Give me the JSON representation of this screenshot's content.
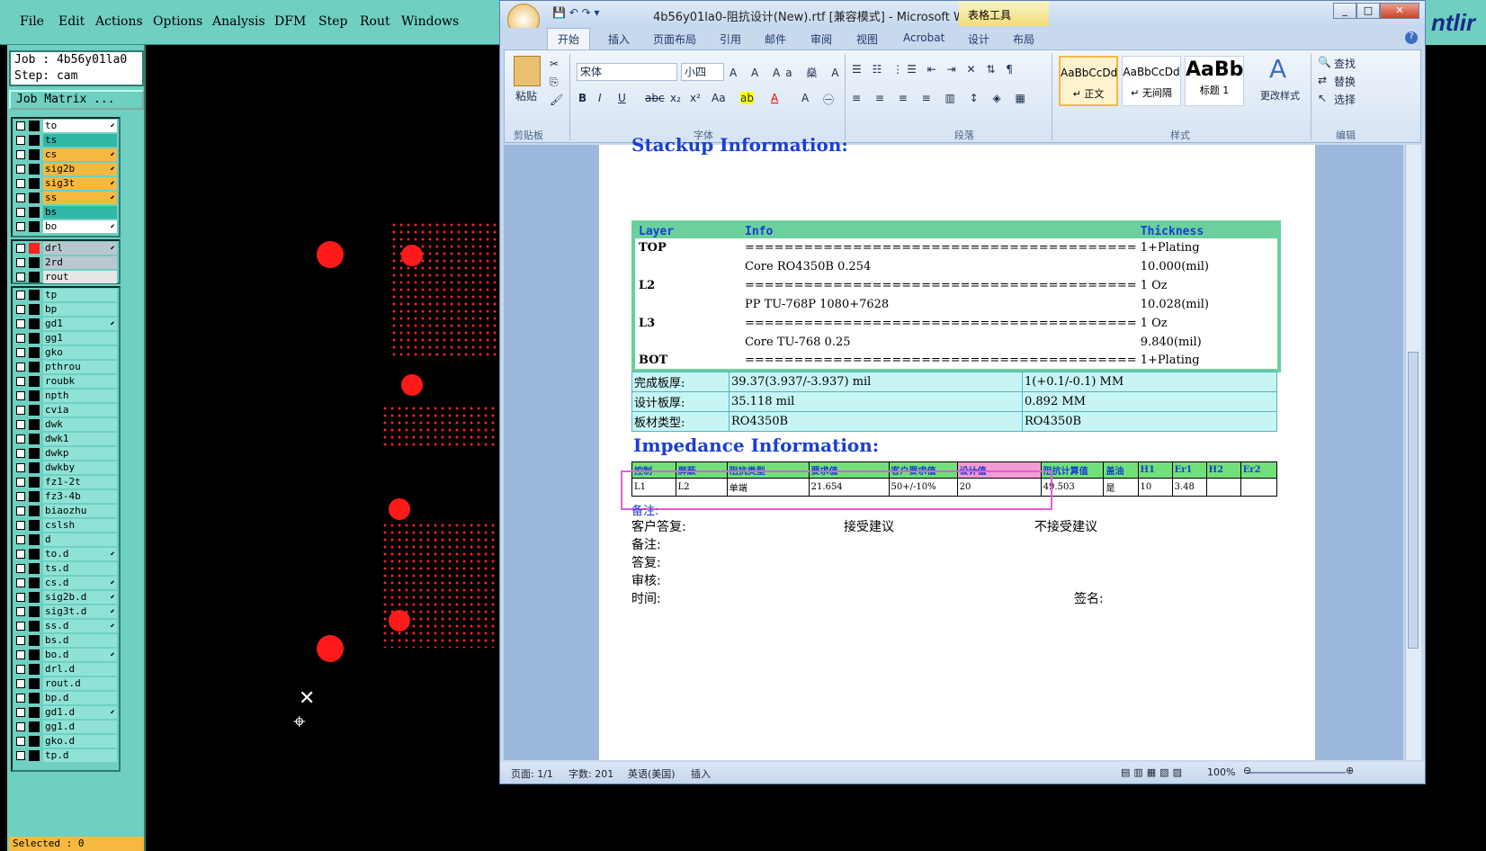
{
  "cam": {
    "menu": [
      "File",
      "Edit",
      "Actions",
      "Options",
      "Analysis",
      "DFM",
      "Step",
      "Rout",
      "Windows"
    ],
    "job_line": "Job : 4b56y01la0",
    "step_line": "Step: cam",
    "job_matrix": "Job Matrix ...",
    "selected": "Selected : 0",
    "brand_partial": "ntlir",
    "layers_group1": [
      {
        "name": "to",
        "color": "#ffffff",
        "arrow": true
      },
      {
        "name": "ts",
        "color": "#2fb8a6",
        "arrow": false
      },
      {
        "name": "cs",
        "color": "#f5b942",
        "arrow": true
      },
      {
        "name": "sig2b",
        "color": "#f5b942",
        "arrow": true
      },
      {
        "name": "sig3t",
        "color": "#f5b942",
        "arrow": true
      },
      {
        "name": "ss",
        "color": "#f5b942",
        "arrow": true
      },
      {
        "name": "bs",
        "color": "#2fb8a6",
        "arrow": false
      },
      {
        "name": "bo",
        "color": "#ffffff",
        "arrow": true
      }
    ],
    "layers_group2": [
      {
        "name": "drl",
        "color": "#b8c8d0",
        "arrow": true
      },
      {
        "name": "2rd",
        "color": "#b8c8d0",
        "arrow": false
      },
      {
        "name": "rout",
        "color": "#e6e6e6",
        "arrow": false
      }
    ],
    "layers_group3": [
      {
        "name": "tp",
        "arrow": false
      },
      {
        "name": "bp",
        "arrow": false
      },
      {
        "name": "gd1",
        "arrow": true
      },
      {
        "name": "gg1",
        "arrow": false
      },
      {
        "name": "gko",
        "arrow": false
      },
      {
        "name": "pthrou",
        "arrow": false
      },
      {
        "name": "roubk",
        "arrow": false
      },
      {
        "name": "npth",
        "arrow": false
      },
      {
        "name": "cvia",
        "arrow": false
      },
      {
        "name": "dwk",
        "arrow": false
      },
      {
        "name": "dwk1",
        "arrow": false
      },
      {
        "name": "dwkp",
        "arrow": false
      },
      {
        "name": "dwkby",
        "arrow": false
      },
      {
        "name": "fz1-2t",
        "arrow": false
      },
      {
        "name": "fz3-4b",
        "arrow": false
      },
      {
        "name": "biaozhu",
        "arrow": false
      },
      {
        "name": "cslsh",
        "arrow": false
      },
      {
        "name": "d",
        "arrow": false
      },
      {
        "name": "to.d",
        "arrow": true
      },
      {
        "name": "ts.d",
        "arrow": false
      },
      {
        "name": "cs.d",
        "arrow": true
      },
      {
        "name": "sig2b.d",
        "arrow": true
      },
      {
        "name": "sig3t.d",
        "arrow": true
      },
      {
        "name": "ss.d",
        "arrow": true
      },
      {
        "name": "bs.d",
        "arrow": false
      },
      {
        "name": "bo.d",
        "arrow": true
      },
      {
        "name": "drl.d",
        "arrow": false
      },
      {
        "name": "rout.d",
        "arrow": false
      },
      {
        "name": "bp.d",
        "arrow": false
      },
      {
        "name": "gd1.d",
        "arrow": true
      },
      {
        "name": "gg1.d",
        "arrow": false
      },
      {
        "name": "gko.d",
        "arrow": false
      },
      {
        "name": "tp.d",
        "arrow": false
      }
    ]
  },
  "word": {
    "title": "4b56y01la0-阻抗设计(New).rtf [兼容模式] - Microsoft Word",
    "table_tools": "表格工具",
    "tabs": [
      "开始",
      "插入",
      "页面布局",
      "引用",
      "邮件",
      "审阅",
      "视图",
      "Acrobat",
      "设计",
      "布局"
    ],
    "ribbon": {
      "paste": "粘贴",
      "clipboard": "剪贴板",
      "font_name": "宋体",
      "font_size": "小四",
      "font_group": "字体",
      "para_group": "段落",
      "styles_group": "样式",
      "edit_group": "编辑",
      "styles": [
        {
          "preview": "AaBbCcDd",
          "name": "↵ 正文"
        },
        {
          "preview": "AaBbCcDd",
          "name": "↵ 无间隔"
        },
        {
          "preview": "AaBb",
          "name": "标题 1"
        }
      ],
      "change_styles": "更改样式",
      "find": "查找",
      "replace": "替换",
      "select": "选择"
    },
    "status": {
      "page": "页面: 1/1",
      "words": "字数: 201",
      "lang": "英语(美国)",
      "mode": "插入",
      "zoom": "100%"
    }
  },
  "doc": {
    "stackup_heading": "Stackup Information:",
    "stackup_headers": [
      "Layer",
      "Info",
      "Thickness"
    ],
    "stackup_rows": [
      [
        "TOP",
        "========================================",
        "1+Plating"
      ],
      [
        "",
        "Core     RO4350B     0.254",
        "10.000(mil)"
      ],
      [
        "L2",
        "========================================",
        "1 Oz"
      ],
      [
        "",
        "PP     TU-768P     1080+7628",
        "10.028(mil)"
      ],
      [
        "L3",
        "========================================",
        "1 Oz"
      ],
      [
        "",
        "Core     TU-768     0.25",
        "9.840(mil)"
      ],
      [
        "BOT",
        "========================================",
        "1+Plating"
      ]
    ],
    "board_rows": [
      [
        "完成板厚:",
        "39.37(3.937/-3.937) mil",
        "1(+0.1/-0.1) MM"
      ],
      [
        "设计板厚:",
        "35.118 mil",
        "0.892 MM"
      ],
      [
        "板材类型:",
        "RO4350B",
        "RO4350B"
      ]
    ],
    "impedance_heading": "Impedance Information:",
    "imp_headers": [
      "控制",
      "屏蔽",
      "阻抗类型",
      "要求值",
      "客户要求值",
      "设计值",
      "阻抗计算值",
      "盖油",
      "H1",
      "Er1",
      "H2",
      "Er2"
    ],
    "imp_row": [
      "L1",
      "L2",
      "单端",
      "21.654",
      "50+/-10%",
      "20",
      "49.503",
      "是",
      "10",
      "3.48",
      "",
      ""
    ],
    "note_line": "备注:",
    "customer_reply": "客户答复:",
    "accept": "接受建议",
    "reject": "不接受建议",
    "note2": "备注:",
    "reply": "答复:",
    "review": "审核:",
    "time": "时间:",
    "sign": "签名:"
  }
}
